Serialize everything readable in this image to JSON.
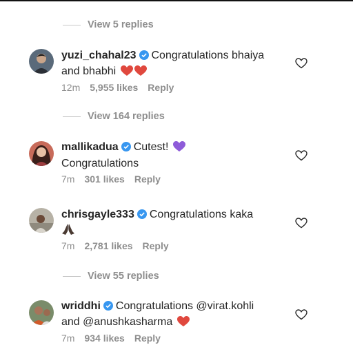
{
  "view_replies": [
    "View 5 replies",
    "View 164 replies",
    "View 55 replies"
  ],
  "comments": [
    {
      "username": "yuzi_chahal23",
      "line1": "Congratulations bhaiya",
      "line2": "and bhabhi",
      "time": "12m",
      "likes": "5,955 likes",
      "reply": "Reply",
      "emoji": "red-heart ×2"
    },
    {
      "username": "mallikadua",
      "line1": "Cutest!",
      "line2": "Congratulations",
      "time": "7m",
      "likes": "301 likes",
      "reply": "Reply",
      "emoji": "purple-heart"
    },
    {
      "username": "chrisgayle333",
      "line1": "Congratulations kaka",
      "line2": "",
      "time": "7m",
      "likes": "2,781 likes",
      "reply": "Reply",
      "emoji": "folded-hands"
    },
    {
      "username": "wriddhi",
      "line1": "Congratulations @virat.kohli",
      "line2": "and @anushkasharma",
      "time": "7m",
      "likes": "934 likes",
      "reply": "Reply",
      "emoji": "red-heart"
    }
  ],
  "colors": {
    "verified_badge": "#3897f0",
    "heart_red": "#e0483e",
    "heart_purple": "#8e5cd9",
    "secondary_text": "#8e8e8e"
  }
}
